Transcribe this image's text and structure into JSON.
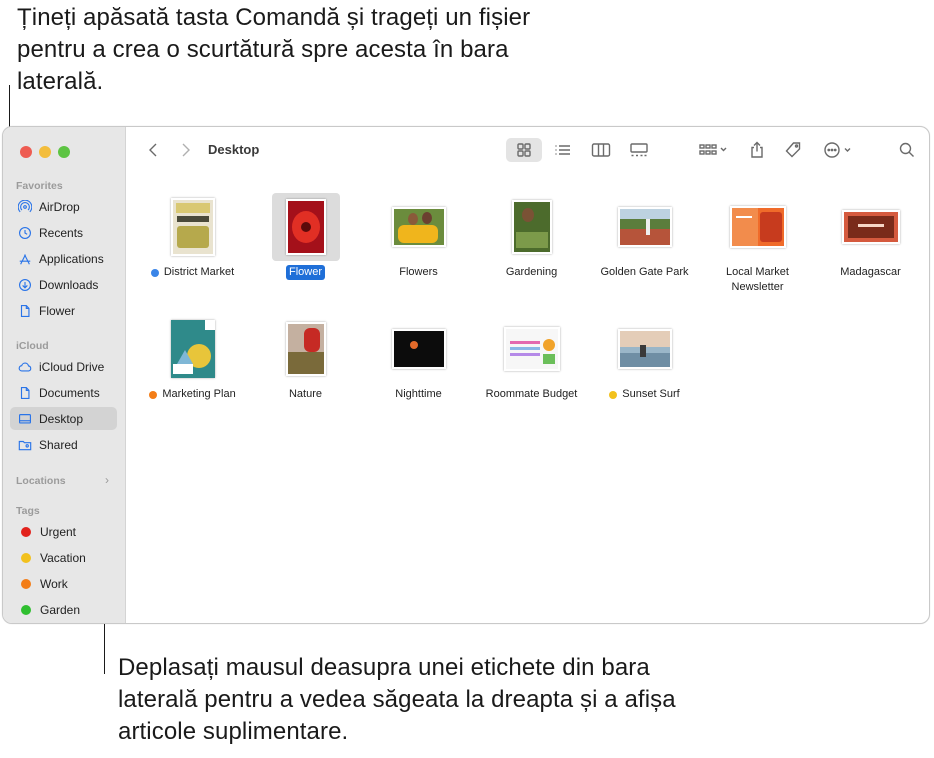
{
  "callouts": {
    "top": "Țineți apăsată tasta Comandă și trageți un fișier pentru a crea o scurtătură spre acesta în bara laterală.",
    "bottom": "Deplasați mausul deasupra unei etichete din bara laterală pentru a vedea săgeata la dreapta și a afișa articole suplimentare."
  },
  "colors": {
    "accent": "#2a74e8",
    "selection": "#1f6fd8",
    "tag_red": "#e2221c",
    "tag_yellow": "#f2c11d",
    "tag_orange": "#f37d17",
    "tag_green": "#2fbf30",
    "tag_blue": "#3a85e8"
  },
  "sidebar": {
    "sections": {
      "favorites": "Favorites",
      "icloud": "iCloud",
      "locations": "Locations",
      "tags": "Tags"
    },
    "favorites": [
      {
        "label": "AirDrop",
        "icon": "airdrop-icon"
      },
      {
        "label": "Recents",
        "icon": "clock-icon"
      },
      {
        "label": "Applications",
        "icon": "applications-icon"
      },
      {
        "label": "Downloads",
        "icon": "download-icon"
      },
      {
        "label": "Flower",
        "icon": "document-icon"
      }
    ],
    "icloud": [
      {
        "label": "iCloud Drive",
        "icon": "cloud-icon"
      },
      {
        "label": "Documents",
        "icon": "document-icon"
      },
      {
        "label": "Desktop",
        "icon": "desktop-icon",
        "active": true
      },
      {
        "label": "Shared",
        "icon": "shared-folder-icon"
      }
    ],
    "tags": [
      {
        "label": "Urgent",
        "color": "#e2221c"
      },
      {
        "label": "Vacation",
        "color": "#f2c11d"
      },
      {
        "label": "Work",
        "color": "#f37d17"
      },
      {
        "label": "Garden",
        "color": "#2fbf30"
      }
    ]
  },
  "toolbar": {
    "title": "Desktop",
    "buttons": [
      "back-icon",
      "forward-icon",
      "icon-view-icon",
      "list-view-icon",
      "column-view-icon",
      "gallery-view-icon",
      "group-icon",
      "share-icon",
      "tag-icon",
      "more-icon",
      "search-icon"
    ]
  },
  "files": [
    {
      "name": "District Market",
      "tag": "#3a85e8"
    },
    {
      "name": "Flower",
      "selected": true
    },
    {
      "name": "Flowers"
    },
    {
      "name": "Gardening"
    },
    {
      "name": "Golden Gate Park"
    },
    {
      "name": "Local Market Newsletter"
    },
    {
      "name": "Madagascar"
    },
    {
      "name": "Marketing Plan",
      "tag": "#f37d17"
    },
    {
      "name": "Nature"
    },
    {
      "name": "Nighttime"
    },
    {
      "name": "Roommate Budget"
    },
    {
      "name": "Sunset Surf",
      "tag": "#f2c11d"
    }
  ]
}
